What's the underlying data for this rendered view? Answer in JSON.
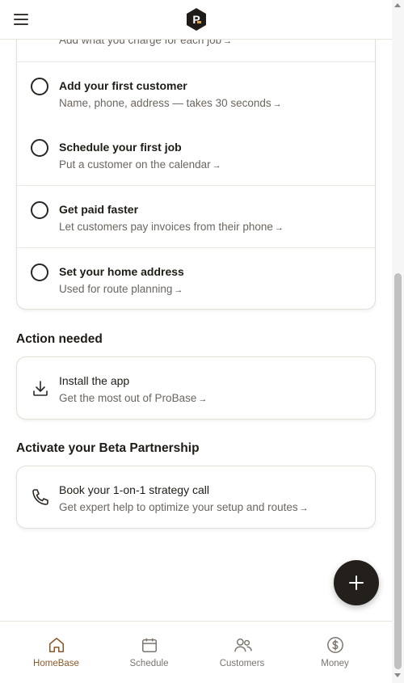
{
  "header": {
    "menu_icon": "hamburger-menu-icon",
    "logo_icon": "probase-logo"
  },
  "checklist": {
    "partial_item": {
      "subtitle": "Add what you charge for each job"
    },
    "items": [
      {
        "title": "Add your first customer",
        "subtitle": "Name, phone, address — takes 30 seconds"
      },
      {
        "title": "Schedule your first job",
        "subtitle": "Put a customer on the calendar"
      },
      {
        "title": "Get paid faster",
        "subtitle": "Let customers pay invoices from their phone"
      },
      {
        "title": "Set your home address",
        "subtitle": "Used for route planning"
      }
    ],
    "arrow": "→"
  },
  "action_needed": {
    "heading": "Action needed",
    "card": {
      "title": "Install the app",
      "subtitle": "Get the most out of ProBase",
      "icon": "download-icon"
    }
  },
  "beta": {
    "heading": "Activate your Beta Partnership",
    "card": {
      "title": "Book your 1-on-1 strategy call",
      "subtitle": "Get expert help to optimize your setup and routes",
      "icon": "phone-icon"
    }
  },
  "fab": {
    "icon": "plus-icon"
  },
  "bottom_nav": {
    "items": [
      {
        "label": "HomeBase",
        "icon": "home-icon",
        "active": true
      },
      {
        "label": "Schedule",
        "icon": "calendar-icon",
        "active": false
      },
      {
        "label": "Customers",
        "icon": "users-icon",
        "active": false
      },
      {
        "label": "Money",
        "icon": "dollar-icon",
        "active": false
      }
    ]
  },
  "colors": {
    "accent": "#8a5a2b",
    "text": "#1f1b16",
    "muted": "#6b6560",
    "fab": "#231f1b"
  }
}
